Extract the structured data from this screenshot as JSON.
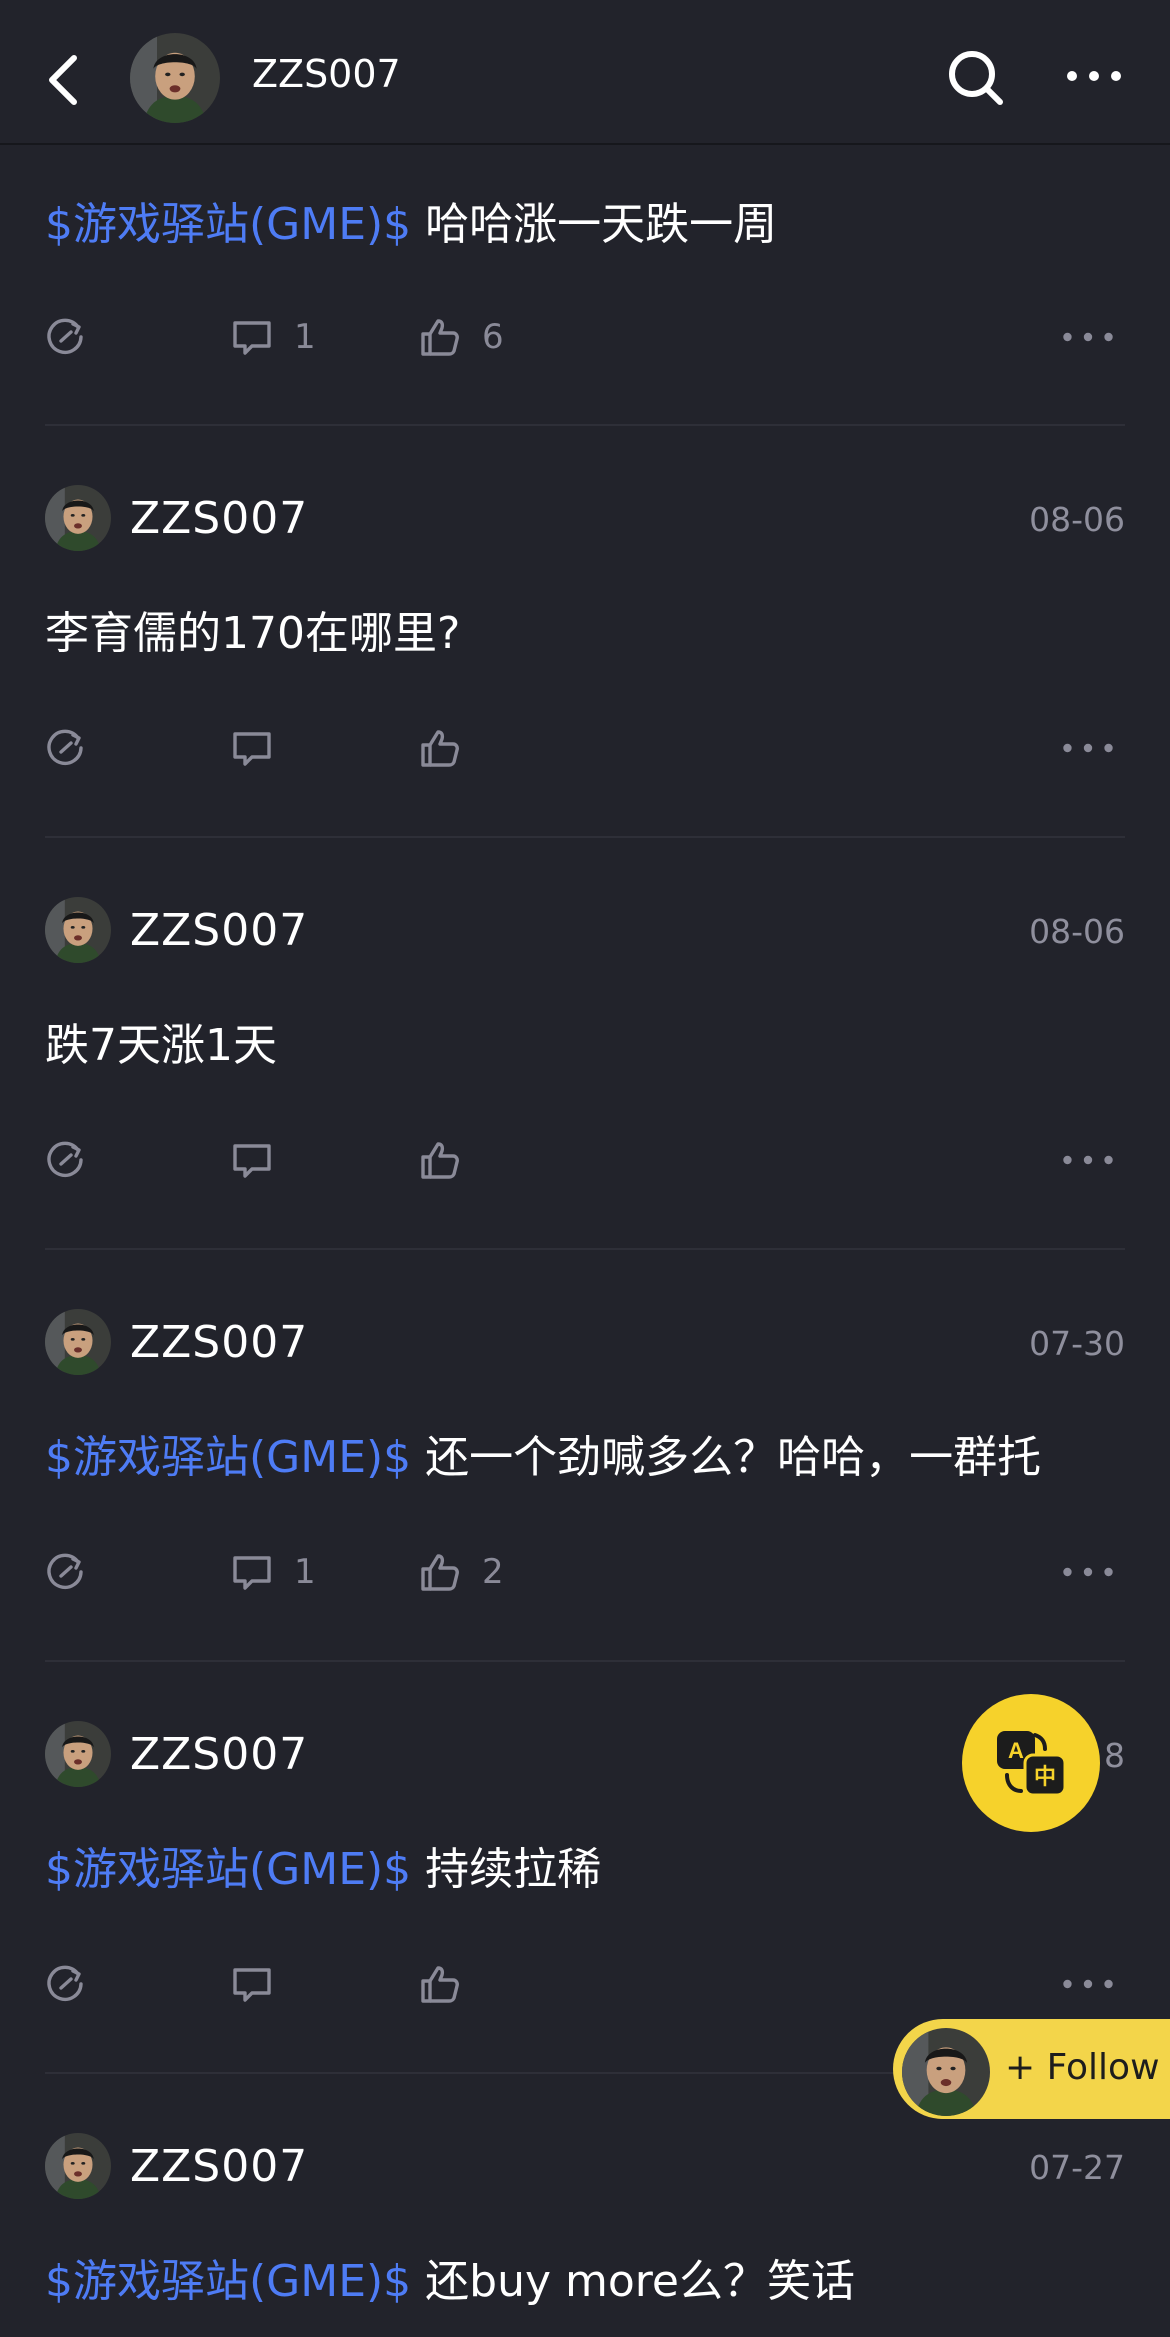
{
  "header": {
    "username": "ZZS007"
  },
  "posts": [
    {
      "author": "",
      "date": "",
      "ticker": "$游戏驿站(GME)$",
      "text": " 哈哈涨一天跌一周",
      "comments": "1",
      "likes": "6"
    },
    {
      "author": "ZZS007",
      "date": "08-06",
      "ticker": "",
      "text": "李育儒的170在哪里?",
      "comments": "",
      "likes": ""
    },
    {
      "author": "ZZS007",
      "date": "08-06",
      "ticker": "",
      "text": "跌7天涨1天",
      "comments": "",
      "likes": ""
    },
    {
      "author": "ZZS007",
      "date": "07-30",
      "ticker": "$游戏驿站(GME)$",
      "text": " 还一个劲喊多么？哈哈，一群托",
      "comments": "1",
      "likes": "2"
    },
    {
      "author": "ZZS007",
      "date": "",
      "ticker": "$游戏驿站(GME)$",
      "text": " 持续拉稀",
      "comments": "",
      "likes": ""
    },
    {
      "author": "ZZS007",
      "date": "07-27",
      "ticker": "$游戏驿站(GME)$",
      "text": " 还buy more么？笑话",
      "comments": "",
      "likes": ""
    }
  ],
  "fab": {
    "icon": "translate-icon",
    "glyph_a": "A",
    "glyph_zh": "中",
    "partial_date": "8"
  },
  "follow": {
    "label": "+ Follow"
  },
  "icons": {
    "back": "chevron-left-icon",
    "search": "search-icon",
    "more": "more-horizontal-icon",
    "share": "share-icon",
    "comment": "comment-icon",
    "like": "thumbs-up-icon"
  },
  "colors": {
    "background": "#22232b",
    "ticker": "#4e7cf5",
    "accent": "#f6d22b",
    "muted": "#8a8a98"
  }
}
